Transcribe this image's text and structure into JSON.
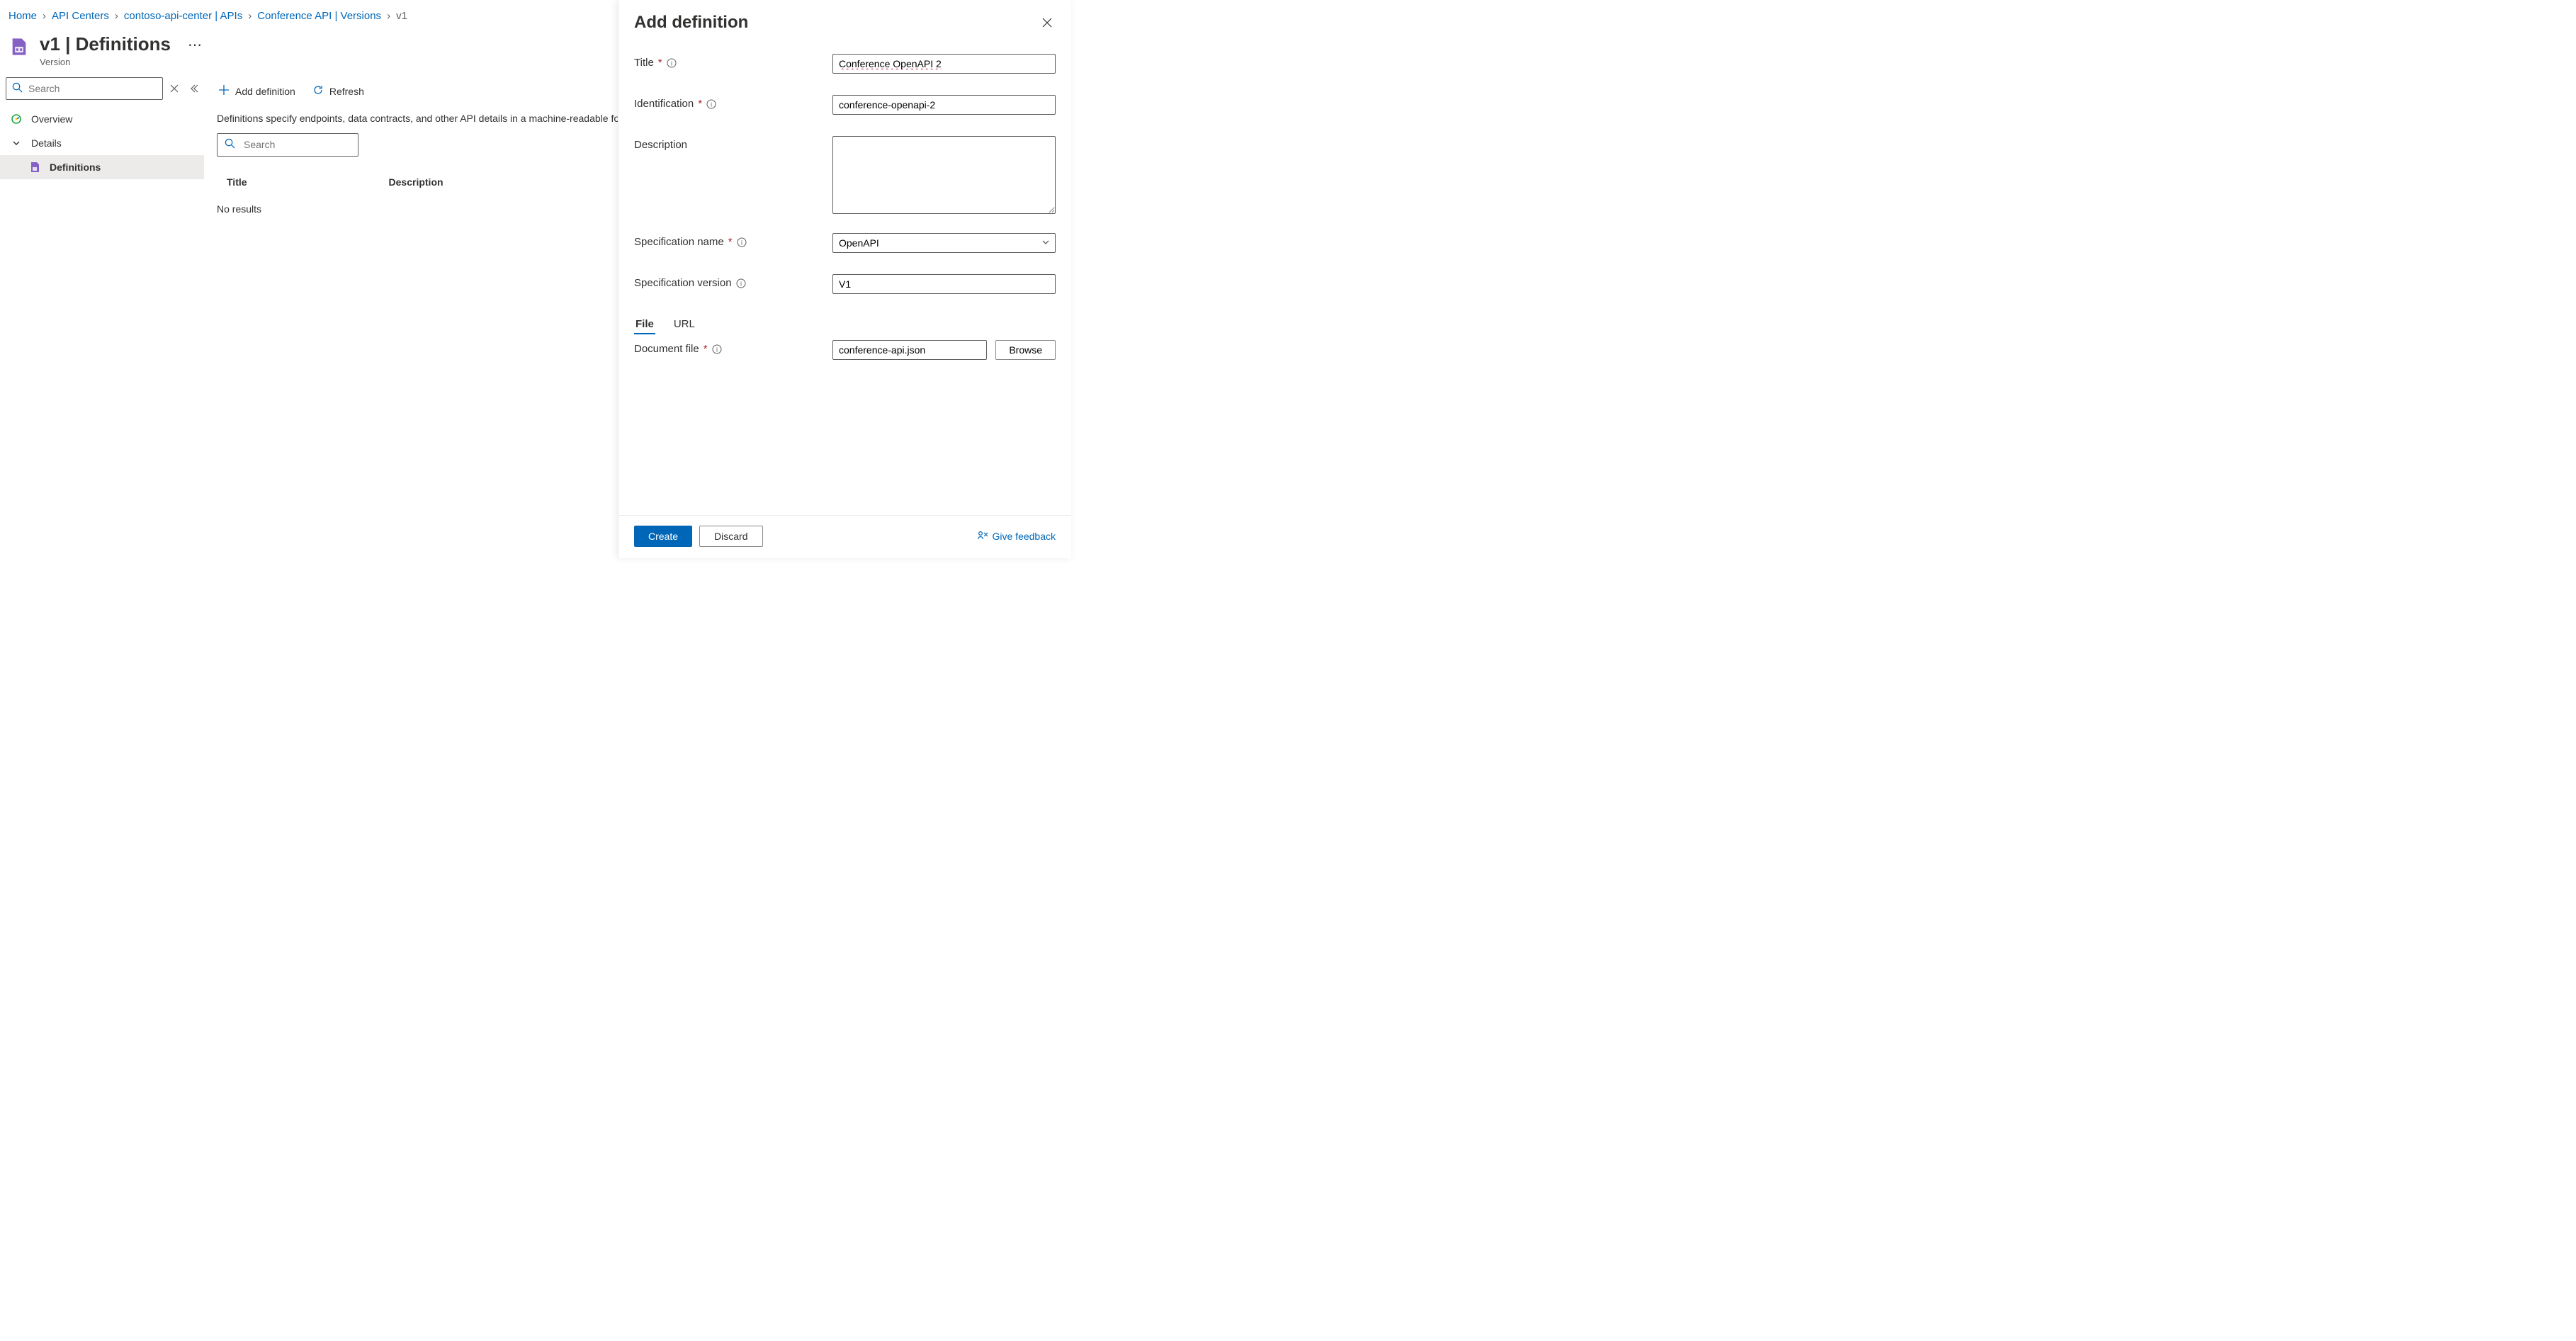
{
  "breadcrumb": {
    "items": [
      "Home",
      "API Centers",
      "contoso-api-center | APIs",
      "Conference API | Versions"
    ],
    "current": "v1"
  },
  "header": {
    "title": "v1 | Definitions",
    "subtitle": "Version"
  },
  "sidebar": {
    "search_placeholder": "Search",
    "items": [
      {
        "label": "Overview"
      },
      {
        "label": "Details"
      },
      {
        "label": "Definitions"
      }
    ]
  },
  "toolbar": {
    "add_label": "Add definition",
    "refresh_label": "Refresh"
  },
  "content": {
    "description": "Definitions specify endpoints, data contracts, and other API details in a machine-readable format. Azure API Center supports OpenAPI and AsyncAPI specifications.",
    "search_placeholder": "Search",
    "columns": {
      "title": "Title",
      "description": "Description"
    },
    "no_results": "No results"
  },
  "panel": {
    "title": "Add definition",
    "fields": {
      "title": {
        "label": "Title",
        "value": "Conference OpenAPI 2"
      },
      "identification": {
        "label": "Identification",
        "value": "conference-openapi-2"
      },
      "description": {
        "label": "Description",
        "value": ""
      },
      "spec_name": {
        "label": "Specification name",
        "value": "OpenAPI"
      },
      "spec_version": {
        "label": "Specification version",
        "value": "V1"
      },
      "doc_file": {
        "label": "Document file",
        "value": "conference-api.json"
      }
    },
    "tabs": {
      "file": "File",
      "url": "URL"
    },
    "browse_label": "Browse",
    "footer": {
      "create": "Create",
      "discard": "Discard",
      "feedback": "Give feedback"
    }
  }
}
